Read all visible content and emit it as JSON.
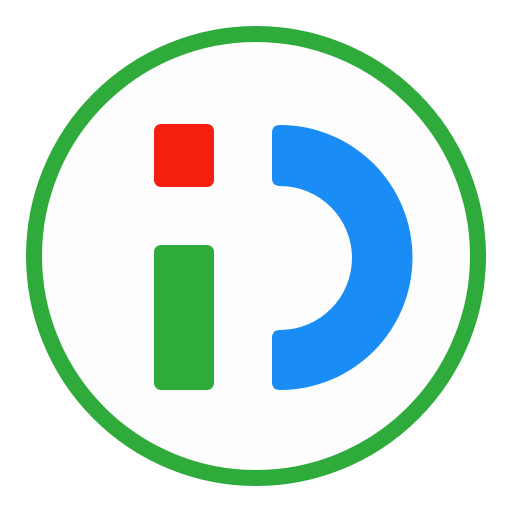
{
  "logo": {
    "icon": "app-logo-id-icon",
    "colors": {
      "ring": "#2eab3a",
      "background": "#fdfdfd",
      "dot": "#f41f0f",
      "stem": "#2eab3a",
      "d_shape": "#1a8cf6"
    }
  }
}
